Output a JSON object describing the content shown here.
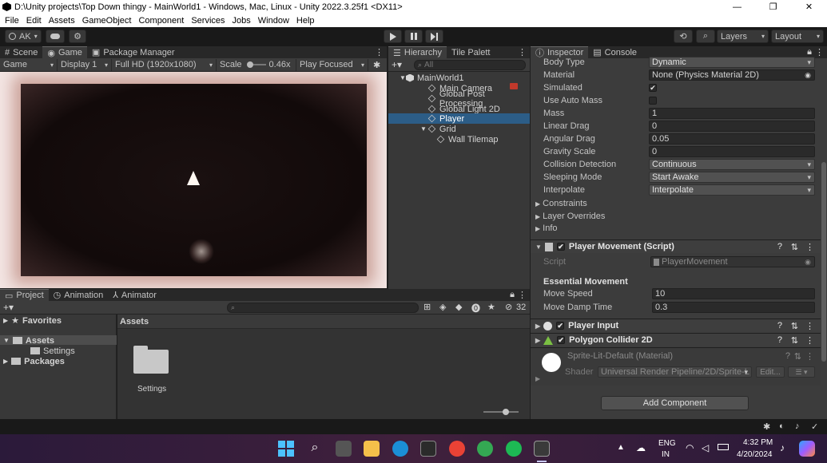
{
  "window": {
    "title": "D:\\Unity projects\\Top Down thingy - MainWorld1 - Windows, Mac, Linux - Unity 2022.3.25f1 <DX11>",
    "controls": [
      "—",
      "❐",
      "✕"
    ]
  },
  "menu": [
    "File",
    "Edit",
    "Assets",
    "GameObject",
    "Component",
    "Services",
    "Jobs",
    "Window",
    "Help"
  ],
  "toolbar": {
    "account": "AK",
    "layers": "Layers",
    "layout": "Layout"
  },
  "left_tabs": [
    "Scene",
    "Game",
    "Package Manager"
  ],
  "game": {
    "view": "Game",
    "display": "Display 1",
    "resolution": "Full HD (1920x1080)",
    "scale_label": "Scale",
    "scale_value": "0.46x",
    "play_mode": "Play Focused"
  },
  "hierarchy": {
    "tabs": [
      "Hierarchy",
      "Tile Palett"
    ],
    "search_placeholder": "All",
    "scene": "MainWorld1",
    "items": [
      "Main Camera",
      "Global Post Processing",
      "Global Light 2D",
      "Player",
      "Grid",
      "Wall Tilemap"
    ],
    "selected": "Player"
  },
  "inspector": {
    "tabs": [
      "Inspector",
      "Console"
    ],
    "rigidbody": [
      {
        "label": "Body Type",
        "value": "Dynamic"
      },
      {
        "label": "Material",
        "value": "None (Physics Material 2D)"
      },
      {
        "label": "Simulated",
        "value": "✔"
      },
      {
        "label": "Use Auto Mass",
        "value": ""
      },
      {
        "label": "Mass",
        "value": "1"
      },
      {
        "label": "Linear Drag",
        "value": "0"
      },
      {
        "label": "Angular Drag",
        "value": "0.05"
      },
      {
        "label": "Gravity Scale",
        "value": "0"
      },
      {
        "label": "Collision Detection",
        "value": "Continuous"
      },
      {
        "label": "Sleeping Mode",
        "value": "Start Awake"
      },
      {
        "label": "Interpolate",
        "value": "Interpolate"
      }
    ],
    "foldouts": [
      "Constraints",
      "Layer Overrides",
      "Info"
    ],
    "player_movement": {
      "title": "Player Movement (Script)",
      "script_label": "Script",
      "script_value": "PlayerMovement",
      "section": "Essential Movement",
      "move_speed_label": "Move Speed",
      "move_speed": "10",
      "damp_label": "Move Damp Time",
      "damp": "0.3"
    },
    "player_input": "Player Input",
    "polygon_collider": "Polygon Collider 2D",
    "material": {
      "name": "Sprite-Lit-Default (Material)",
      "shader_label": "Shader",
      "shader_value": "Universal Render Pipeline/2D/Sprite-L",
      "edit": "Edit..."
    },
    "add_component": "Add Component"
  },
  "bottom_tabs": [
    "Project",
    "Animation",
    "Animator"
  ],
  "project": {
    "hidden_count": "32",
    "tree": [
      {
        "label": "Favorites"
      },
      {
        "label": "Assets"
      },
      {
        "label": "Settings"
      },
      {
        "label": "Packages"
      }
    ],
    "breadcrumb": "Assets",
    "folder": "Settings"
  },
  "taskbar": {
    "language": "ENG",
    "region": "IN",
    "time": "4:32 PM",
    "date": "4/20/2024"
  },
  "colors": {
    "selection": "#2c5d87",
    "accent_cube": "#c8c8c8",
    "game_frame": "#f4e6e4"
  }
}
